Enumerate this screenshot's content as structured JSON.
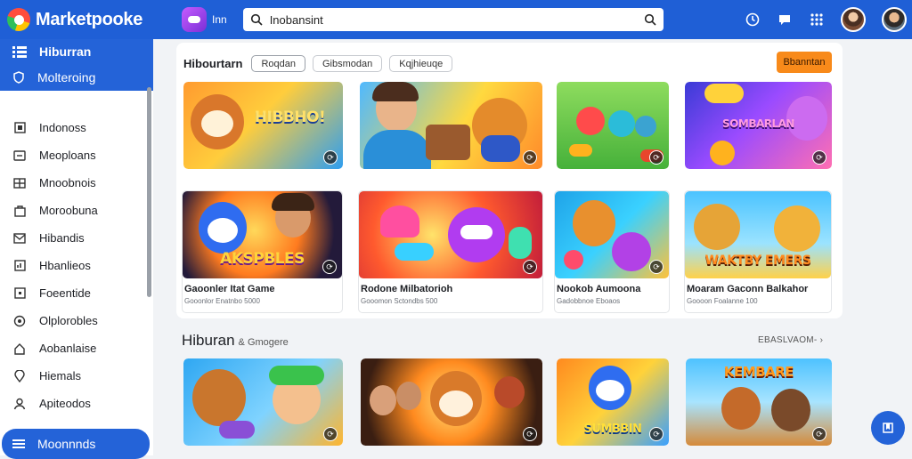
{
  "header": {
    "brand": "Marketpooke",
    "app_label": "Inn",
    "search_value": "Inobansint"
  },
  "sidebar": {
    "title": "Hiburran",
    "active": "Molteroing",
    "items": [
      {
        "label": "Indonoss",
        "icon": "box-icon"
      },
      {
        "label": "Meoploans",
        "icon": "list-icon"
      },
      {
        "label": "Mnoobnois",
        "icon": "grid-icon"
      },
      {
        "label": "Moroobuna",
        "icon": "bag-icon"
      },
      {
        "label": "Hibandis",
        "icon": "mail-icon"
      },
      {
        "label": "Hbanlieos",
        "icon": "chart-icon"
      },
      {
        "label": "Foeentide",
        "icon": "square-icon"
      },
      {
        "label": "Olplorobles",
        "icon": "circle-icon"
      },
      {
        "label": "Aobanlaise",
        "icon": "home-icon"
      },
      {
        "label": "Hiemals",
        "icon": "pin-icon"
      },
      {
        "label": "Apiteodos",
        "icon": "user-icon"
      }
    ],
    "bottom": "Moonnnds"
  },
  "panel": {
    "title": "Hibourtarn",
    "chips": [
      "Roqdan",
      "Gibsmodan",
      "Kqjhieuqe"
    ],
    "cta": "Bbanntan"
  },
  "cards_row1": [
    {
      "art": "HIBBHO!"
    },
    {
      "art": ""
    },
    {
      "art": ""
    },
    {
      "art": "SOMBARLAN"
    }
  ],
  "cards_row2": [
    {
      "art": "AKSPBLES",
      "title": "Gaoonler Itat Game",
      "sub": "Gooonlor Enatnbo 5000"
    },
    {
      "art": "",
      "title": "Rodone Milbatorioh",
      "sub": "Gooomon Sctondbs 500"
    },
    {
      "art": "",
      "title": "Nookob Aumoona",
      "sub": "Gadobbnoe Eboaos"
    },
    {
      "art": "WAKTBY EMERS",
      "title": "Moaram Gaconn Balkahor",
      "sub": "Goooon Foalanne 100"
    }
  ],
  "section2": {
    "title": "Hiburan",
    "subtitle": "& Gmogere",
    "see_all": "EBASLVAOM-"
  },
  "cards_row3": [
    {
      "art": ""
    },
    {
      "art": ""
    },
    {
      "art": "SUMBBIN"
    },
    {
      "art": "KEMBARE"
    }
  ],
  "colors": {
    "accent": "#1f5fd6",
    "cta": "#f88a1a"
  }
}
